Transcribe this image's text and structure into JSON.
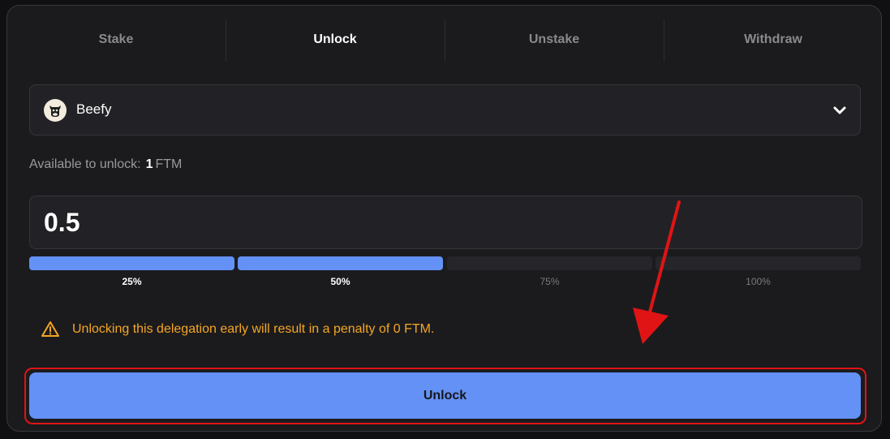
{
  "tabs": [
    {
      "label": "Stake",
      "active": false
    },
    {
      "label": "Unlock",
      "active": true
    },
    {
      "label": "Unstake",
      "active": false
    },
    {
      "label": "Withdraw",
      "active": false
    }
  ],
  "validator_select": {
    "label": "Beefy",
    "logo_icon": "cow-logo-icon",
    "chevron_icon": "chevron-down-icon"
  },
  "available": {
    "label": "Available to unlock:",
    "amount": "1",
    "unit": "FTM"
  },
  "amount_input": {
    "value": "0.5"
  },
  "percent_options": [
    {
      "label": "25%",
      "filled": true
    },
    {
      "label": "50%",
      "filled": true
    },
    {
      "label": "75%",
      "filled": false
    },
    {
      "label": "100%",
      "filled": false
    }
  ],
  "selected_percent": 50,
  "warning": {
    "icon": "warning-triangle-icon",
    "text": "Unlocking this delegation early will result in a penalty of 0 FTM."
  },
  "unlock_button": {
    "label": "Unlock"
  },
  "colors": {
    "accent": "#6491f5",
    "warning": "#f5a623",
    "annotation": "#e01414",
    "panel": "#1b1b1e"
  }
}
